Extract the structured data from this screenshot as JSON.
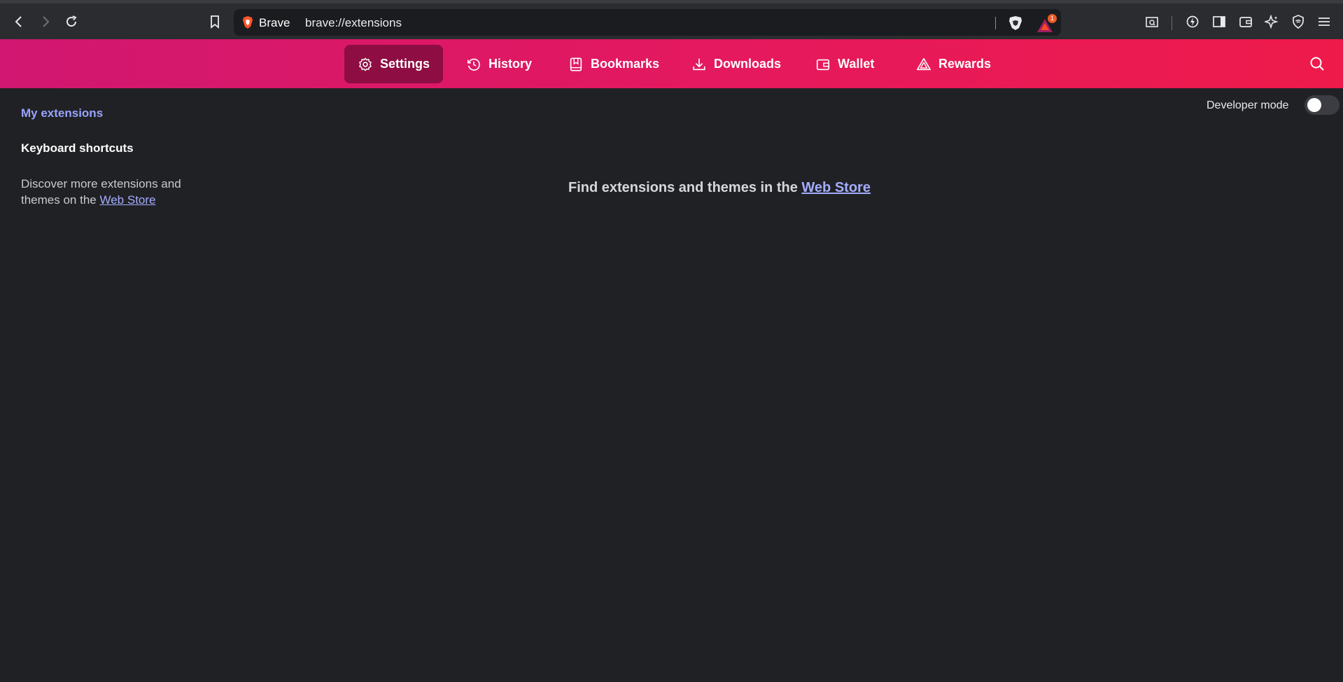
{
  "browser": {
    "brand": "Brave",
    "url": "brave://extensions",
    "rewards_badge": "1"
  },
  "nav": {
    "items": [
      {
        "label": "Settings",
        "icon": "gear-icon",
        "active": true
      },
      {
        "label": "History",
        "icon": "history-icon",
        "active": false
      },
      {
        "label": "Bookmarks",
        "icon": "bookmarks-icon",
        "active": false
      },
      {
        "label": "Downloads",
        "icon": "download-icon",
        "active": false
      },
      {
        "label": "Wallet",
        "icon": "wallet-icon",
        "active": false
      },
      {
        "label": "Rewards",
        "icon": "rewards-icon",
        "active": false
      }
    ]
  },
  "sidebar": {
    "my_extensions": "My extensions",
    "keyboard_shortcuts": "Keyboard shortcuts",
    "discover_prefix": "Discover more extensions and themes on the",
    "web_store": "Web Store"
  },
  "developer_mode": {
    "label": "Developer mode",
    "enabled": false
  },
  "main": {
    "message_prefix": "Find extensions and themes in the",
    "web_store": "Web Store"
  },
  "colors": {
    "accent_link": "#99a3ff",
    "nav_gradient_start": "#d11771",
    "nav_gradient_end": "#ee1a4a",
    "nav_active": "#8e0d42",
    "background": "#202124"
  }
}
